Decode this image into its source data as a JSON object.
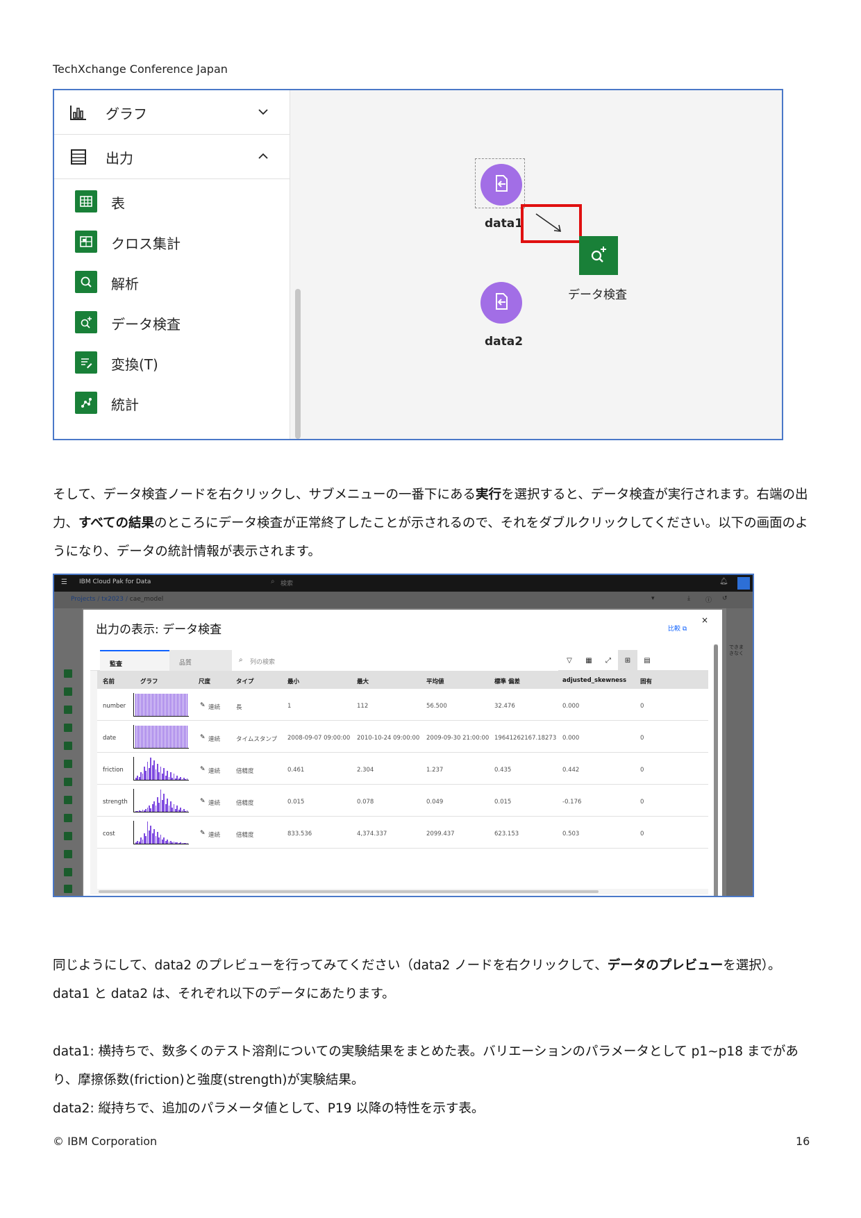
{
  "header": {
    "conference": "TechXchange Conference Japan"
  },
  "screenshot1": {
    "palette": {
      "categories": [
        {
          "label": "グラフ",
          "icon": "bar-chart-icon",
          "state": "collapsed"
        },
        {
          "label": "出力",
          "icon": "list-icon",
          "state": "expanded"
        }
      ],
      "items": [
        {
          "label": "表",
          "icon": "table-icon"
        },
        {
          "label": "クロス集計",
          "icon": "crosstab-icon"
        },
        {
          "label": "解析",
          "icon": "analysis-icon"
        },
        {
          "label": "データ検査",
          "icon": "data-audit-icon"
        },
        {
          "label": "変換(T)",
          "icon": "transform-icon"
        },
        {
          "label": "統計",
          "icon": "statistics-icon"
        }
      ]
    },
    "canvas": {
      "nodes": [
        {
          "label": "data1",
          "icon": "import-icon"
        },
        {
          "label": "data2",
          "icon": "import-icon"
        },
        {
          "label": "データ検査",
          "icon": "data-audit-icon"
        }
      ]
    },
    "colors": {
      "node_purple": "#a26ee6",
      "node_green": "#198038",
      "highlight_red": "#e01010"
    }
  },
  "paragraph1": {
    "t1": "そして、データ検査ノードを右クリックし、サブメニューの一番下にある",
    "b1": "実行",
    "t2": "を選択すると、データ検査が実行されます。右端の出力、",
    "b2": "すべての結果",
    "t3": "のところにデータ検査が正常終了したことが示されるので、それをダブルクリックしてください。以下の画面のようになり、データの統計情報が表示されます。"
  },
  "screenshot2": {
    "app": {
      "brand": "IBM Cloud Pak for Data",
      "search_placeholder": "検索",
      "breadcrumb": [
        "Projects",
        "tx2023",
        "cae_model"
      ],
      "right_fragment_1": "できま",
      "right_fragment_2": "きなく"
    },
    "modal": {
      "title": "出力の表示: データ検査",
      "compare_label": "比較",
      "close": "×",
      "tabs": [
        "監査",
        "品質"
      ],
      "search_placeholder": "列の検索",
      "columns": [
        "名前",
        "グラフ",
        "尺度",
        "タイプ",
        "最小",
        "最大",
        "平均値",
        "標準 偏差",
        "adjusted_skewness",
        "固有"
      ],
      "rows": [
        {
          "name": "number",
          "measure": "連続",
          "type": "長",
          "min": "1",
          "max": "112",
          "mean": "56.500",
          "std": "32.476",
          "skew": "0.000",
          "unique": "0",
          "hist": [
            30,
            30,
            30,
            30,
            30,
            30,
            30,
            30,
            30,
            30,
            30,
            30,
            30,
            30,
            30,
            30,
            30,
            30,
            30,
            30,
            30,
            30,
            30,
            30,
            30,
            30,
            30,
            30,
            30,
            30,
            30,
            30,
            30,
            30,
            30,
            30,
            30,
            30
          ]
        },
        {
          "name": "date",
          "measure": "連続",
          "type": "タイムスタンプ",
          "min": "2008-09-07 09:00:00",
          "max": "2010-10-24 09:00:00",
          "mean": "2009-09-30 21:00:00",
          "std": "19641262167.18273",
          "skew": "0.000",
          "unique": "0",
          "hist": [
            30,
            30,
            30,
            30,
            30,
            30,
            30,
            30,
            30,
            30,
            30,
            30,
            30,
            30,
            30,
            30,
            30,
            30,
            30,
            30,
            30,
            30,
            30,
            30,
            30,
            30,
            30,
            30,
            30,
            30,
            30,
            30,
            30,
            30,
            30,
            30,
            30,
            30
          ]
        },
        {
          "name": "friction",
          "measure": "連続",
          "type": "倍精度",
          "min": "0.461",
          "max": "2.304",
          "mean": "1.237",
          "std": "0.435",
          "skew": "0.442",
          "unique": "0",
          "hist": [
            3,
            6,
            4,
            10,
            8,
            18,
            12,
            24,
            16,
            30,
            20,
            26,
            14,
            22,
            10,
            18,
            8,
            16,
            6,
            12,
            4,
            10,
            3,
            8,
            2,
            6,
            2,
            4,
            1,
            3,
            1,
            2
          ]
        },
        {
          "name": "strength",
          "measure": "連続",
          "type": "倍精度",
          "min": "0.015",
          "max": "0.078",
          "mean": "0.049",
          "std": "0.015",
          "skew": "-0.176",
          "unique": "0",
          "hist": [
            1,
            1,
            2,
            1,
            3,
            2,
            4,
            6,
            8,
            5,
            10,
            14,
            8,
            20,
            12,
            30,
            16,
            24,
            10,
            18,
            8,
            14,
            6,
            10,
            4,
            8,
            3,
            6,
            2,
            4,
            1,
            2
          ]
        },
        {
          "name": "cost",
          "measure": "連続",
          "type": "倍精度",
          "min": "833.536",
          "max": "4,374.337",
          "mean": "2099.437",
          "std": "623.153",
          "skew": "0.503",
          "unique": "0",
          "hist": [
            2,
            4,
            3,
            8,
            6,
            14,
            10,
            30,
            18,
            24,
            14,
            20,
            10,
            16,
            8,
            12,
            6,
            8,
            4,
            6,
            3,
            4,
            2,
            3,
            2,
            2,
            1,
            2,
            1,
            1,
            1,
            1
          ]
        }
      ]
    }
  },
  "paragraph2": {
    "t1": "同じようにして、data2 のプレビューを行ってみてください（data2 ノードを右クリックして、",
    "b1": "データのプレビュー",
    "t2": "を選択）。",
    "line2": "data1 と data2 は、それぞれ以下のデータにあたります。"
  },
  "paragraph3": {
    "line1": "data1: 横持ちで、数多くのテスト溶剤についての実験結果をまとめた表。バリエーションのパラメータとして p1~p18 までがあり、摩擦係数(friction)と強度(strength)が実験結果。",
    "line2": "data2: 縦持ちで、追加のパラメータ値として、P19 以降の特性を示す表。"
  },
  "footer": {
    "copyright": "© IBM Corporation",
    "page_number": "16"
  }
}
